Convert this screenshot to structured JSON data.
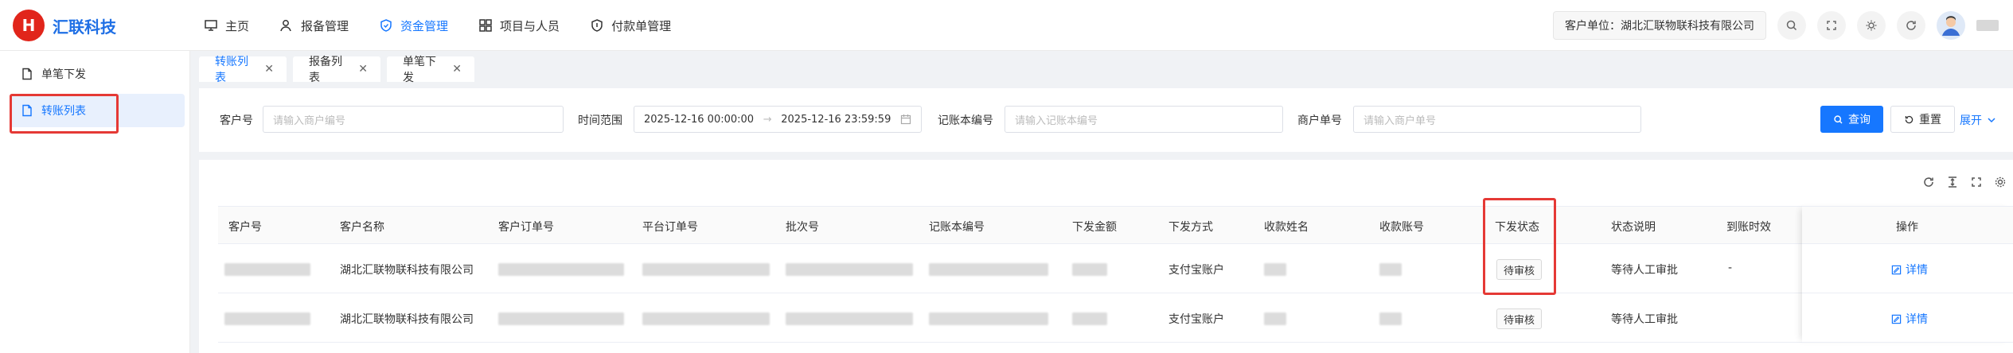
{
  "app": {
    "brand_logo_text": "汇联科技",
    "brand_mark": "H"
  },
  "nav": {
    "home": "主页",
    "report": "报备管理",
    "funds": "资金管理",
    "projects": "项目与人员",
    "payment": "付款单管理"
  },
  "header": {
    "company": "客户单位：湖北汇联物联科技有限公司"
  },
  "sidebar": {
    "items": [
      {
        "label": "单笔下发"
      },
      {
        "label": "转账列表"
      }
    ]
  },
  "tabs": [
    {
      "label": "转账列表",
      "active": true
    },
    {
      "label": "报备列表",
      "active": false
    },
    {
      "label": "单笔下发",
      "active": false
    }
  ],
  "filter": {
    "customer_label": "客户号",
    "customer_placeholder": "请输入商户编号",
    "time_label": "时间范围",
    "start": "2025-12-16 00:00:00",
    "end": "2025-12-16 23:59:59",
    "ledger_label": "记账本编号",
    "ledger_placeholder": "请输入记账本编号",
    "merchant_label": "商户单号",
    "merchant_placeholder": "请输入商户单号",
    "search": "查询",
    "reset": "重置",
    "expand": "展开"
  },
  "table": {
    "columns": [
      "客户号",
      "客户名称",
      "客户订单号",
      "平台订单号",
      "批次号",
      "记账本编号",
      "下发金额",
      "下发方式",
      "收款姓名",
      "收款账号",
      "下发状态",
      "状态说明",
      "到账时效",
      "操作"
    ],
    "rows": [
      {
        "name": "湖北汇联物联科技有限公司",
        "method": "支付宝账户",
        "status": "待审核",
        "desc": "等待人工审批",
        "arrival": "-",
        "op": "详情"
      },
      {
        "name": "湖北汇联物联科技有限公司",
        "method": "支付宝账户",
        "status": "待审核",
        "desc": "等待人工审批",
        "arrival": "",
        "op": "详情"
      }
    ]
  },
  "colors": {
    "primary": "#1677ff",
    "brand_red": "#e1251b",
    "highlight": "#e53935"
  }
}
